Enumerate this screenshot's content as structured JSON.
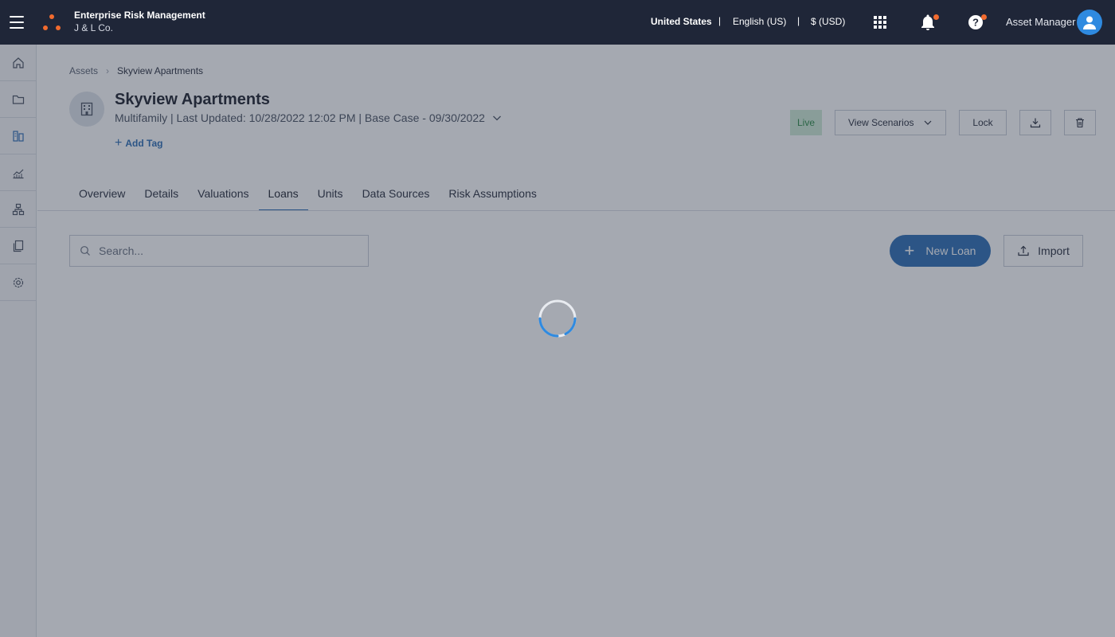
{
  "header": {
    "app_name": "Enterprise Risk Management",
    "org_name": "J & L Co.",
    "country": "United States",
    "separator": "|",
    "language": "English (US)",
    "currency": "$ (USD)",
    "user_role": "Asset Manager",
    "colors": {
      "bar": "#1f2638",
      "badge": "#f26b2e",
      "avatar": "#2f8ae0"
    }
  },
  "sidebar": {
    "items": [
      {
        "icon": "home-icon"
      },
      {
        "icon": "folder-icon"
      },
      {
        "icon": "assets-icon"
      },
      {
        "icon": "chart-icon"
      },
      {
        "icon": "hierarchy-icon"
      },
      {
        "icon": "documents-icon"
      },
      {
        "icon": "settings-icon"
      }
    ]
  },
  "breadcrumb": {
    "root": "Assets",
    "current": "Skyview Apartments"
  },
  "asset": {
    "title": "Skyview Apartments",
    "subtitle": "Multifamily | Last Updated: 10/28/2022 12:02 PM | Base Case - 09/30/2022",
    "add_tag": "Add Tag",
    "status": "Live"
  },
  "actions": {
    "view_scenarios": "View Scenarios",
    "lock": "Lock"
  },
  "tabs": [
    {
      "label": "Overview",
      "active": false
    },
    {
      "label": "Details",
      "active": false
    },
    {
      "label": "Valuations",
      "active": false
    },
    {
      "label": "Loans",
      "active": true
    },
    {
      "label": "Units",
      "active": false
    },
    {
      "label": "Data Sources",
      "active": false
    },
    {
      "label": "Risk Assumptions",
      "active": false
    }
  ],
  "loans": {
    "search_placeholder": "Search...",
    "new_loan": "New Loan",
    "import": "Import"
  },
  "state": {
    "loading": true,
    "accent": "#2f6fb5"
  }
}
